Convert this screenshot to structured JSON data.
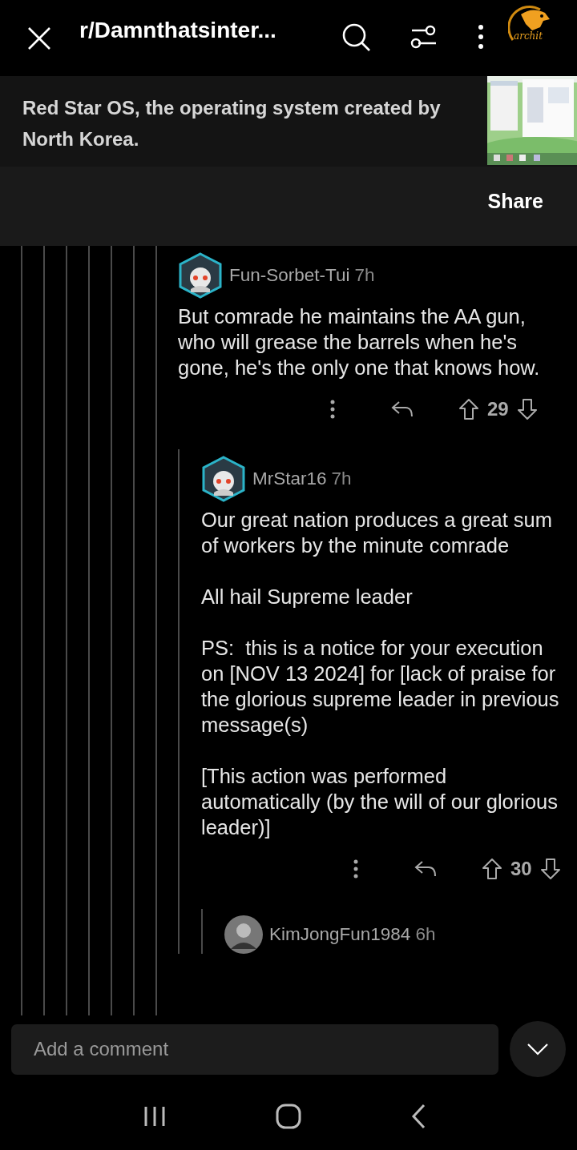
{
  "header": {
    "title": "r/Damnthatsinter...",
    "avatar_label": "archit"
  },
  "post": {
    "title": "Red Star OS, the operating system created by North Korea.",
    "share": "Share"
  },
  "comments": [
    {
      "author": "Fun-Sorbet-Tui",
      "age": "7h",
      "kind": "hexagon",
      "body": "But comrade he maintains the AA gun, who will grease the barrels when he's gone, he's the only one that knows how.",
      "score": "29",
      "children": [
        {
          "author": "MrStar16",
          "age": "7h",
          "kind": "hexagon",
          "body": "Our great nation produces a great sum of workers by the minute comrade\n\nAll hail Supreme leader\n\nPS:  this is a notice for your execution on [NOV 13 2024] for [lack of praise for the glorious supreme leader in previous message(s)\n\n[This action was performed automatically (by the will of our glorious leader)]",
          "score": "30",
          "children": [
            {
              "author": "KimJongFun1984",
              "age": "6h",
              "kind": "circle"
            }
          ]
        }
      ]
    }
  ],
  "comment_bar": {
    "placeholder": "Add a comment"
  }
}
